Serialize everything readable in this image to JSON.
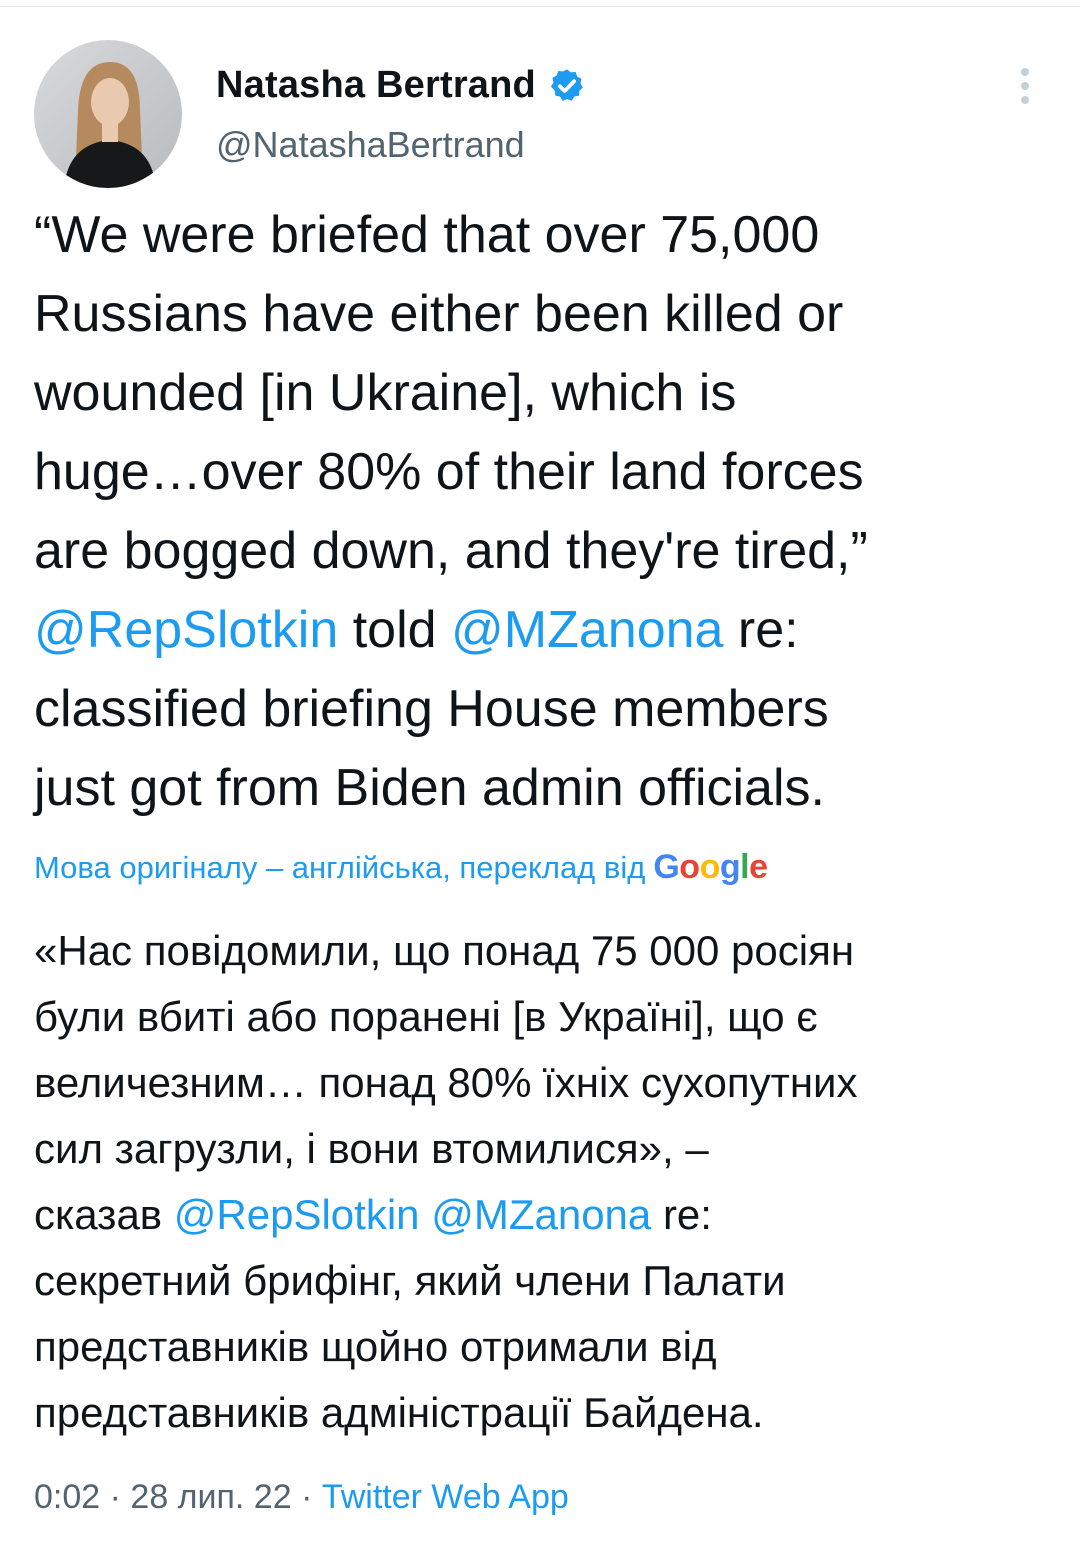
{
  "author": {
    "name": "Natasha Bertrand",
    "handle": "@NatashaBertrand",
    "verified": true
  },
  "tweet": {
    "text_before": "“We were briefed that over 75,000\nRussians have either been killed or\nwounded [in Ukraine], which is\nhuge…over 80% of their land forces\nare bogged down, and they're tired,”\n",
    "mention1": "@RepSlotkin",
    "text_mid": " told ",
    "mention2": "@MZanona",
    "text_after": " re:\nclassified briefing House members\njust got from Biden admin officials."
  },
  "translation": {
    "note": "Мова оригіналу – англійська, переклад від",
    "provider": "Google",
    "text_before": "«Нас повідомили, що понад 75 000 росіян\nбули вбиті або поранені [в Україні], що є\nвеличезним… понад 80% їхніх сухопутних\nсил загрузли, і вони втомилися», –\nсказав ",
    "mention1": "@RepSlotkin",
    "space": " ",
    "mention2": "@MZanona",
    "text_after": " re:\nсекретний брифінг, який члени Палати\nпредставників щойно отримали від\nпредставників адміністрації Байдена."
  },
  "meta": {
    "time": "0:02",
    "separator": " · ",
    "date": "28 лип. 22",
    "source": "Twitter Web App"
  },
  "colors": {
    "link": "#1d9bf0",
    "secondary_text": "#536471",
    "primary_text": "#0f1419"
  }
}
